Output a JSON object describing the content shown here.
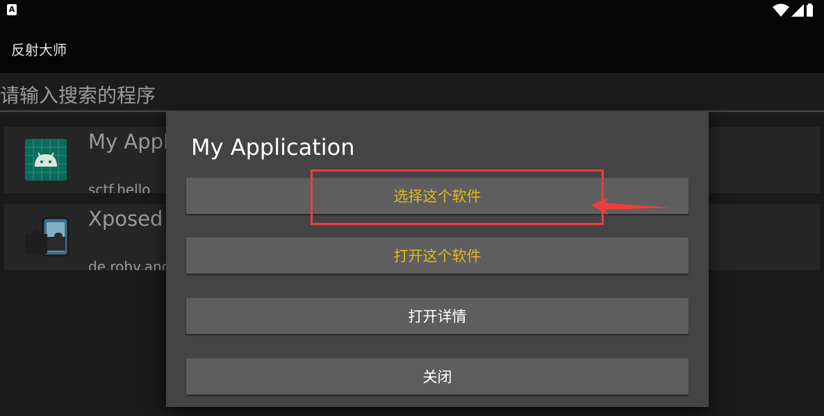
{
  "status_bar": {
    "badge_label": "A",
    "icons": [
      "wifi-icon",
      "cellular-signal-icon",
      "battery-icon"
    ]
  },
  "app_bar": {
    "title": "反射大师"
  },
  "search": {
    "placeholder": "请输入搜索的程序",
    "value": ""
  },
  "app_list": [
    {
      "name": "My Application",
      "package": "sctf.hello",
      "icon": "android-app-icon"
    },
    {
      "name": "Xposed Installer",
      "package": "de.robv.android.xposed.installer",
      "icon": "xposed-puzzle-icon"
    }
  ],
  "dialog": {
    "title": "My Application",
    "buttons": [
      {
        "label": "选择这个软件",
        "color": "#e5b81b"
      },
      {
        "label": "打开这个软件",
        "color": "#e5b81b"
      },
      {
        "label": "打开详情",
        "color": "#ffffff"
      },
      {
        "label": "关闭",
        "color": "#ffffff"
      }
    ]
  },
  "annotation": {
    "color": "#ef3d3d"
  }
}
